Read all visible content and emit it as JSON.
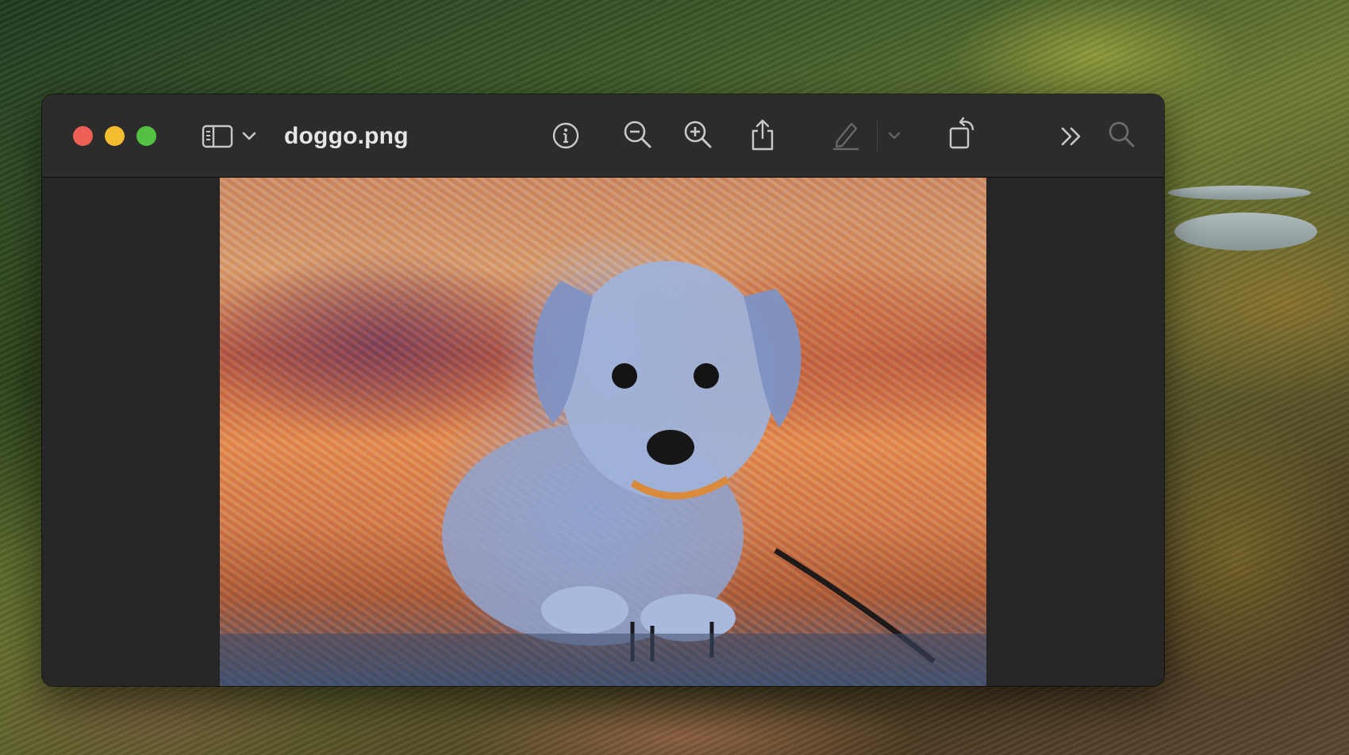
{
  "window": {
    "title": "doggo.png"
  },
  "toolbar": {
    "icons": [
      "sidebar-icon",
      "chevron-down-icon",
      "info-icon",
      "zoom-out-icon",
      "zoom-in-icon",
      "share-icon",
      "markup-icon",
      "markup-chevron-icon",
      "rotate-icon",
      "more-icon",
      "search-icon"
    ]
  },
  "colors": {
    "close": "#ee5f56",
    "minimize": "#f4bd30",
    "maximize": "#55c143",
    "titlebar": "#2c2c2c",
    "content_background": "#262626"
  }
}
